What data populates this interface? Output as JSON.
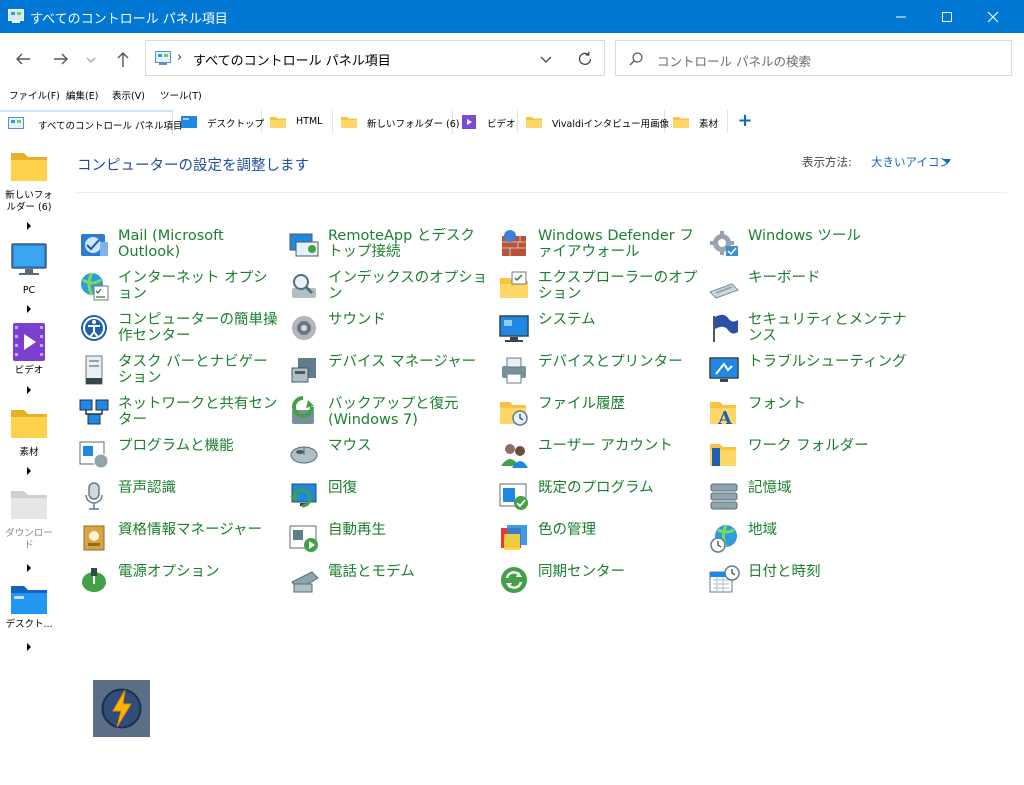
{
  "window": {
    "title": "すべてのコントロール パネル項目"
  },
  "address": {
    "path": "すべてのコントロール パネル項目",
    "search_placeholder": "コントロール パネルの検索"
  },
  "menu": [
    "ファイル(F)",
    "編集(E)",
    "表示(V)",
    "ツール(T)"
  ],
  "tabs": [
    {
      "label": "すべてのコントロール パネル項目",
      "icon": "control-panel-icon",
      "active": true
    },
    {
      "label": "デスクトップ",
      "icon": "desktop-icon"
    },
    {
      "label": "HTML",
      "icon": "folder-icon"
    },
    {
      "label": "新しいフォルダー (6)",
      "icon": "folder-icon"
    },
    {
      "label": "ビデオ",
      "icon": "video-icon"
    },
    {
      "label": "Vivaldiインタビュー用画像",
      "icon": "folder-icon"
    },
    {
      "label": "素材",
      "icon": "folder-icon"
    }
  ],
  "left_pane": [
    {
      "label": "新しいフォルダー (6)",
      "icon": "folder-icon"
    },
    {
      "label": "PC",
      "icon": "pc-icon"
    },
    {
      "label": "ビデオ",
      "icon": "video-icon"
    },
    {
      "label": "素材",
      "icon": "folder-icon"
    },
    {
      "label": "ダウンロード",
      "icon": "download-folder-icon",
      "dimmed": true
    },
    {
      "label": "デスクト...",
      "icon": "desktop-folder-icon"
    }
  ],
  "main": {
    "heading": "コンピューターの設定を調整します",
    "view_label": "表示方法:",
    "view_value": "大きいアイコン",
    "link_color": "#1a7f2e",
    "heading_color": "#1e4e9d",
    "items": [
      {
        "label": "Mail (Microsoft Outlook)",
        "icon": "mail-icon"
      },
      {
        "label": "RemoteApp とデスクトップ接続",
        "icon": "remoteapp-icon"
      },
      {
        "label": "Windows Defender ファイアウォール",
        "icon": "firewall-icon"
      },
      {
        "label": "Windows ツール",
        "icon": "windows-tools-icon"
      },
      {
        "label": "インターネット オプション",
        "icon": "internet-options-icon"
      },
      {
        "label": "インデックスのオプション",
        "icon": "indexing-icon"
      },
      {
        "label": "エクスプローラーのオプション",
        "icon": "explorer-options-icon"
      },
      {
        "label": "キーボード",
        "icon": "keyboard-icon"
      },
      {
        "label": "コンピューターの簡単操作センター",
        "icon": "ease-of-access-icon"
      },
      {
        "label": "サウンド",
        "icon": "sound-icon"
      },
      {
        "label": "システム",
        "icon": "system-icon"
      },
      {
        "label": "セキュリティとメンテナンス",
        "icon": "security-flag-icon"
      },
      {
        "label": "タスク バーとナビゲーション",
        "icon": "taskbar-icon"
      },
      {
        "label": "デバイス マネージャー",
        "icon": "device-manager-icon"
      },
      {
        "label": "デバイスとプリンター",
        "icon": "printer-icon"
      },
      {
        "label": "トラブルシューティング",
        "icon": "troubleshooting-icon"
      },
      {
        "label": "ネットワークと共有センター",
        "icon": "network-icon"
      },
      {
        "label": "バックアップと復元 (Windows 7)",
        "icon": "backup-icon"
      },
      {
        "label": "ファイル履歴",
        "icon": "file-history-icon"
      },
      {
        "label": "フォント",
        "icon": "fonts-icon"
      },
      {
        "label": "プログラムと機能",
        "icon": "programs-icon"
      },
      {
        "label": "マウス",
        "icon": "mouse-icon"
      },
      {
        "label": "ユーザー アカウント",
        "icon": "user-accounts-icon"
      },
      {
        "label": "ワーク フォルダー",
        "icon": "work-folders-icon"
      },
      {
        "label": "音声認識",
        "icon": "microphone-icon"
      },
      {
        "label": "回復",
        "icon": "recovery-icon"
      },
      {
        "label": "既定のプログラム",
        "icon": "default-programs-icon"
      },
      {
        "label": "記憶域",
        "icon": "storage-icon"
      },
      {
        "label": "資格情報マネージャー",
        "icon": "credential-icon"
      },
      {
        "label": "自動再生",
        "icon": "autoplay-icon"
      },
      {
        "label": "色の管理",
        "icon": "color-management-icon"
      },
      {
        "label": "地域",
        "icon": "region-icon"
      },
      {
        "label": "電源オプション",
        "icon": "power-icon"
      },
      {
        "label": "電話とモデム",
        "icon": "phone-modem-icon"
      },
      {
        "label": "同期センター",
        "icon": "sync-icon"
      },
      {
        "label": "日付と時刻",
        "icon": "date-time-icon"
      }
    ]
  },
  "dock_tile": {
    "icon": "lightning-app-icon"
  }
}
